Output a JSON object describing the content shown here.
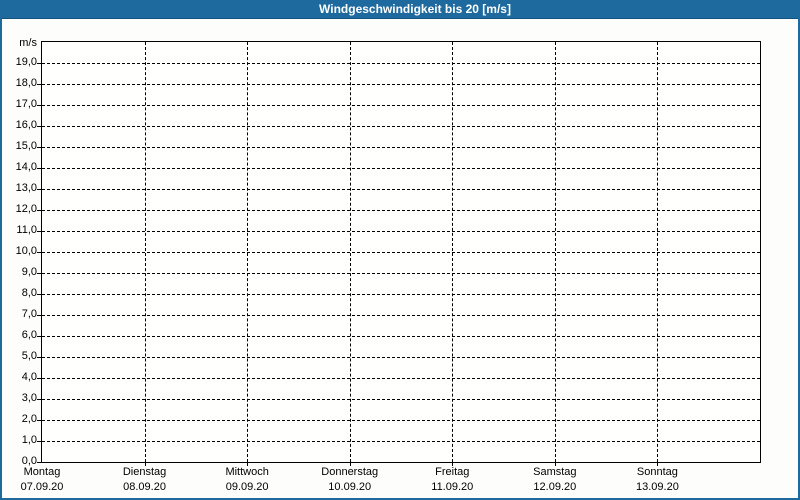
{
  "title_bar": {
    "title": "Windgeschwindigkeit bis 20 [m/s]"
  },
  "colors": {
    "title_bar_bg": "#1e6a9e",
    "title_bar_edge": "#15527c",
    "title_text": "#ffffff",
    "frame_border": "#1e6a9e",
    "grid": "#000000",
    "axis": "#000000",
    "plot_bg": "#fffffe",
    "page_bg": "#fdfdfb",
    "label_text": "#000000"
  },
  "chart_data": {
    "type": "line",
    "title": "Windgeschwindigkeit bis 20 [m/s]",
    "ylabel": "m/s",
    "ylim": [
      0,
      20
    ],
    "y_tick_step": 1.0,
    "y_tick_labels": [
      "0,0",
      "1,0",
      "2,0",
      "3,0",
      "4,0",
      "5,0",
      "6,0",
      "7,0",
      "8,0",
      "9,0",
      "10,0",
      "11,0",
      "12,0",
      "13,0",
      "14,0",
      "15,0",
      "16,0",
      "17,0",
      "18,0",
      "19,0"
    ],
    "x_categories": [
      {
        "day": "Montag",
        "date": "07.09.20"
      },
      {
        "day": "Dienstag",
        "date": "08.09.20"
      },
      {
        "day": "Mittwoch",
        "date": "09.09.20"
      },
      {
        "day": "Donnerstag",
        "date": "10.09.20"
      },
      {
        "day": "Freitag",
        "date": "11.09.20"
      },
      {
        "day": "Samstag",
        "date": "12.09.20"
      },
      {
        "day": "Sonntag",
        "date": "13.09.20"
      }
    ],
    "series": [],
    "grid": "dashed",
    "legend": "none"
  }
}
